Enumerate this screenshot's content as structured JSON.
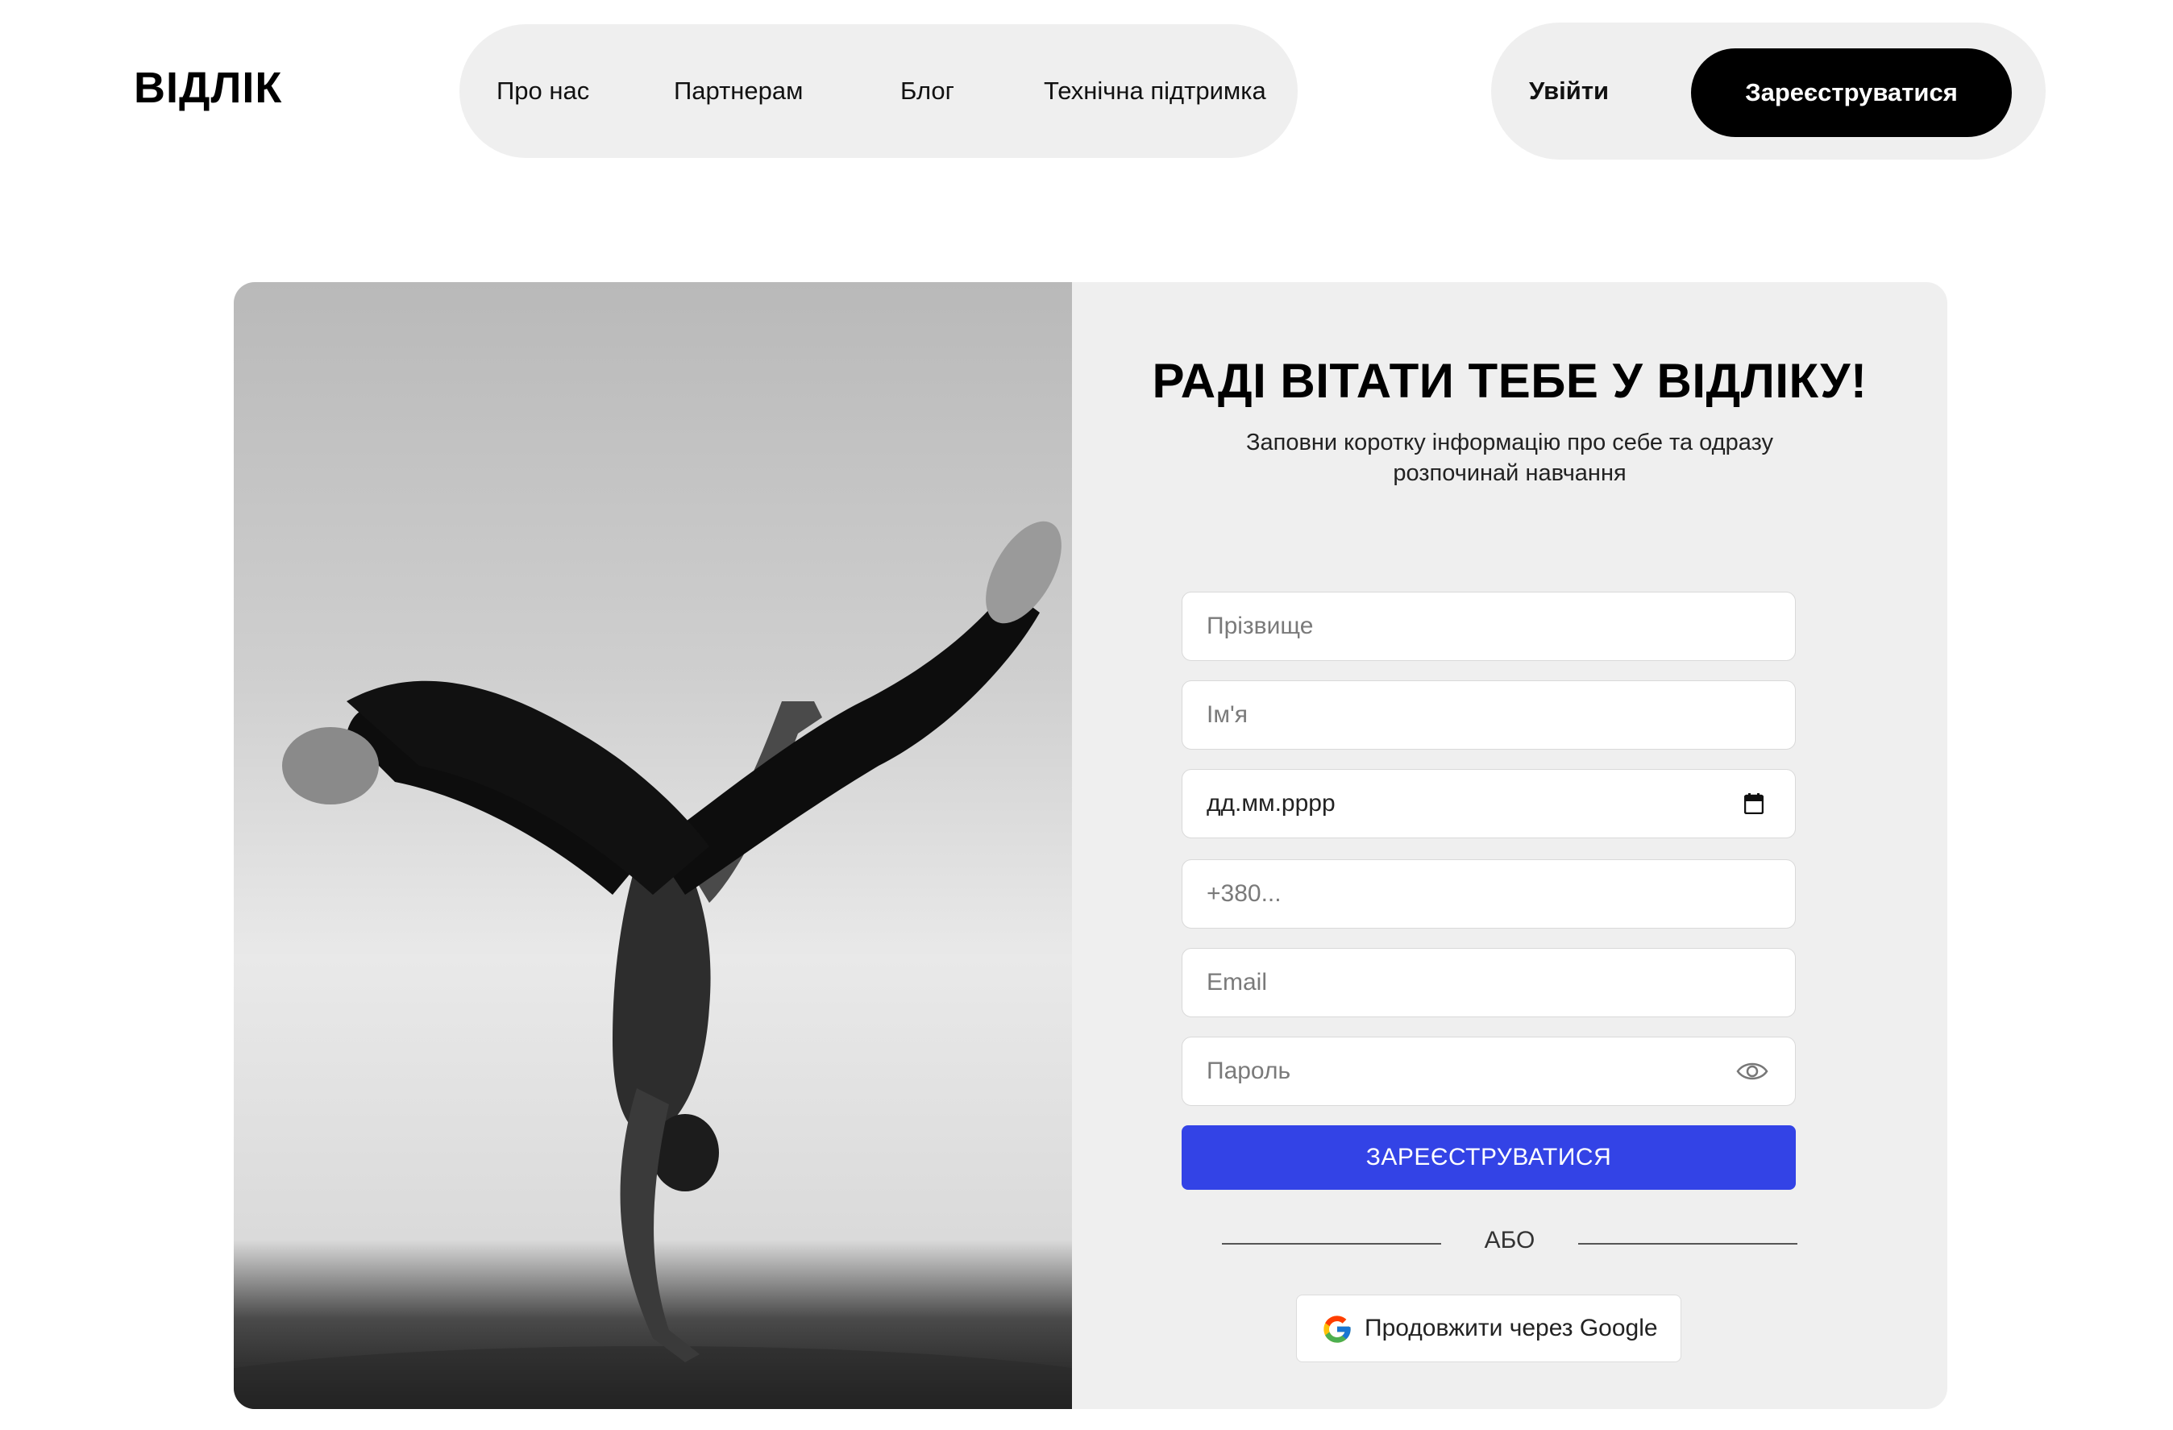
{
  "header": {
    "logo": "ВІДЛІК",
    "nav": [
      {
        "label": "Про нас"
      },
      {
        "label": "Партнерам"
      },
      {
        "label": "Блог"
      },
      {
        "label": "Технічна підтримка"
      }
    ],
    "login_label": "Увійти",
    "register_label": "Зареєструватися"
  },
  "form": {
    "title": "РАДІ ВІТАТИ ТЕБЕ У ВІДЛІКУ!",
    "subtitle": "Заповни коротку інформацію про себе та одразу розпочинай навчання",
    "fields": {
      "surname_placeholder": "Прізвище",
      "name_placeholder": "Ім'я",
      "birthdate_value": "дд.мм.рррр",
      "phone_placeholder": "+380...",
      "email_placeholder": "Email",
      "password_placeholder": "Пароль"
    },
    "submit_label": "ЗАРЕЄСТРУВАТИСЯ",
    "or_label": "АБО",
    "google_label": "Продовжити через Google"
  },
  "colors": {
    "accent": "#3343e6",
    "pill_bg": "#efefef",
    "primary_black": "#000000"
  },
  "icons": [
    "calendar-icon",
    "eye-icon",
    "google-logo-icon"
  ]
}
